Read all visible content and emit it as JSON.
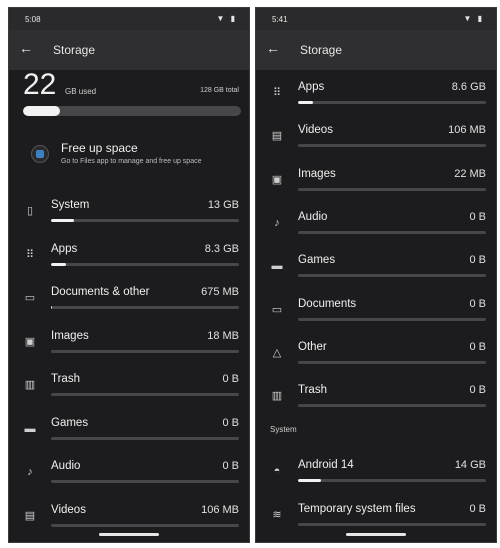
{
  "left": {
    "status": {
      "time": "5:08",
      "left_icon": "sim-icon",
      "right_icons": "▼ ▮"
    },
    "appbar": {
      "title": "Storage"
    },
    "summary": {
      "used_number": "22",
      "used_label": "GB used",
      "total_label": "128 GB total",
      "used_fraction": 0.17
    },
    "free_up": {
      "title": "Free up space",
      "description": "Go to Files app to manage and free up space"
    },
    "rows": [
      {
        "label": "System",
        "value": "13 GB",
        "icon": "phone-icon",
        "fraction": 0.12
      },
      {
        "label": "Apps",
        "value": "8.3 GB",
        "icon": "apps-grid-icon",
        "fraction": 0.08
      },
      {
        "label": "Documents & other",
        "value": "675 MB",
        "icon": "folder-icon",
        "fraction": 0.005
      },
      {
        "label": "Images",
        "value": "18 MB",
        "icon": "images-icon",
        "fraction": 0.0
      },
      {
        "label": "Trash",
        "value": "0 B",
        "icon": "trash-icon",
        "fraction": 0.0
      },
      {
        "label": "Games",
        "value": "0 B",
        "icon": "gamepad-icon",
        "fraction": 0.0
      },
      {
        "label": "Audio",
        "value": "0 B",
        "icon": "music-note-icon",
        "fraction": 0.0
      },
      {
        "label": "Videos",
        "value": "106 MB",
        "icon": "video-icon",
        "fraction": 0.0
      }
    ]
  },
  "right": {
    "status": {
      "time": "5:41",
      "right_icons": "▼ ▮"
    },
    "appbar": {
      "title": "Storage"
    },
    "rows": [
      {
        "label": "Apps",
        "value": "8.6 GB",
        "icon": "apps-grid-icon",
        "fraction": 0.08
      },
      {
        "label": "Videos",
        "value": "106 MB",
        "icon": "video-icon",
        "fraction": 0.0
      },
      {
        "label": "Images",
        "value": "22 MB",
        "icon": "images-icon",
        "fraction": 0.0
      },
      {
        "label": "Audio",
        "value": "0 B",
        "icon": "music-note-icon",
        "fraction": 0.0
      },
      {
        "label": "Games",
        "value": "0 B",
        "icon": "gamepad-icon",
        "fraction": 0.0
      },
      {
        "label": "Documents",
        "value": "0 B",
        "icon": "folder-icon",
        "fraction": 0.0
      },
      {
        "label": "Other",
        "value": "0 B",
        "icon": "shapes-icon",
        "fraction": 0.0
      },
      {
        "label": "Trash",
        "value": "0 B",
        "icon": "trash-icon",
        "fraction": 0.0
      }
    ],
    "section_label": "System",
    "system_rows": [
      {
        "label": "Android 14",
        "value": "14 GB",
        "icon": "android-icon",
        "fraction": 0.12
      },
      {
        "label": "Temporary system files",
        "value": "0 B",
        "icon": "database-icon",
        "fraction": 0.0
      }
    ]
  },
  "colors": {
    "background": "#1c1c1e",
    "appbar": "#2f2f31",
    "track": "#47474a",
    "fill": "#f2f2f2"
  }
}
